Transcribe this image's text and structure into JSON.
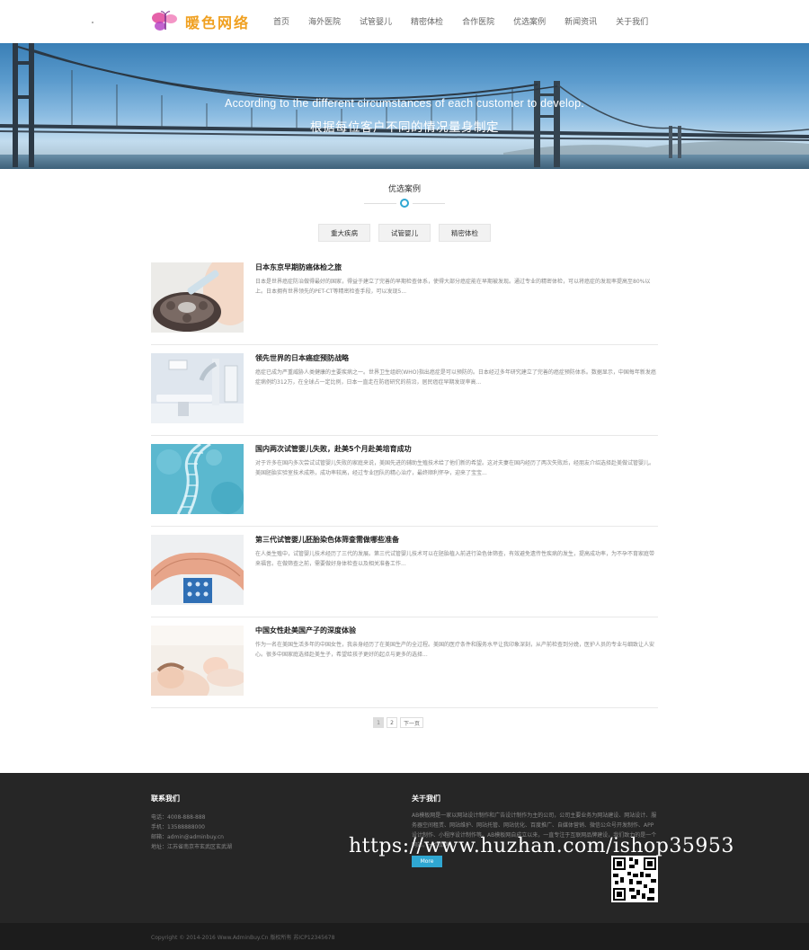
{
  "header": {
    "logo_text": "暖色网络",
    "nav": [
      "首页",
      "海外医院",
      "试管婴儿",
      "精密体检",
      "合作医院",
      "优选案例",
      "新闻资讯",
      "关于我们"
    ]
  },
  "banner": {
    "headline_en": "According to the different circumstances of each customer to develop.",
    "headline_zh": "根据每位客户不同的情况量身制定"
  },
  "section": {
    "title": "优选案例",
    "accent_color": "#2fa7d2",
    "tabs": [
      "重大疾病",
      "试管婴儿",
      "精密体检"
    ]
  },
  "articles": [
    {
      "title": "日本东京早期防癌体检之旅",
      "desc": "日本是世界癌症防治做得最好的国家，得益于建立了完善的早期检查体系，使得大部分癌症能在早期被发现。通过专业的精密体检，可以将癌症的发现率提高至80%以上。日本拥有世界领先的PET-CT等精密检查手段，可以发现5..."
    },
    {
      "title": "领先世界的日本癌症预防战略",
      "desc": "癌症已成为严重威胁人类健康的主要疾病之一。世界卫生组织(WHO)指出癌症是可以预防的。日本经过多年研究建立了完善的癌症预防体系。数据显示，中国每年新发癌症病例约312万，在全球占一定比例，日本一直走在防癌研究的前沿，居民癌症早期发现率高..."
    },
    {
      "title": "国内两次试管婴儿失败，赴美5个月赴美培育成功",
      "desc": "对于许多在国内多次尝试试管婴儿失败的家庭来说，美国先进的辅助生殖技术给了他们新的希望。这对夫妻在国内经历了两次失败后，经朋友介绍选择赴美做试管婴儿。美国胚胎实验室技术成熟，成功率较高，经过专业团队的精心治疗，最终顺利怀孕，迎来了宝宝..."
    },
    {
      "title": "第三代试管婴儿胚胎染色体筛查需做哪些准备",
      "desc": "在人类生殖中，试管婴儿技术经历了三代的发展。第三代试管婴儿技术可以在胚胎植入前进行染色体筛查，有效避免遗传性疾病的发生，提高成功率，为不孕不育家庭带来福音。在做筛查之前，需要做好身体检查以及相关准备工作..."
    },
    {
      "title": "中国女性赴美国产子的深度体验",
      "desc": "作为一名在美国生活多年的中国女性，我亲身经历了在美国生产的全过程。美国的医疗条件和服务水平让我印象深刻，从产前检查到分娩，医护人员的专业与细致让人安心。很多中国家庭选择赴美生子，希望给孩子更好的起点与更多的选择..."
    }
  ],
  "pagination": {
    "pages": [
      "1",
      "2"
    ],
    "next_label": "下一页"
  },
  "footer": {
    "contact_heading": "联系我们",
    "contact_lines": [
      "电话：4008-888-888",
      "手机：13588888000",
      "邮箱：admin@adminbuy.cn",
      "地址：江苏省南京市玄武区玄武湖"
    ],
    "about_heading": "关于我们",
    "about_text": "AB模板网是一家以网站设计制作和广告设计制作为主的公司，公司主要业务为网站建设、网站设计、服务器空间租赁、网站维护、网站托管、网站优化、百度推广、自媒体营销、微信公众号开发制作、APP设计制作、小程序设计制作等。AB模板网自成立以来，一直专注于互联网品牌建设，我们致力的是一个网站，一个品牌...",
    "more_label": "More",
    "watermark": "https://www.huzhan.com/ishop35953",
    "copyright": "Copyright © 2014-2016 Www.AdminBuy.Cn 版权所有  苏ICP12345678"
  }
}
